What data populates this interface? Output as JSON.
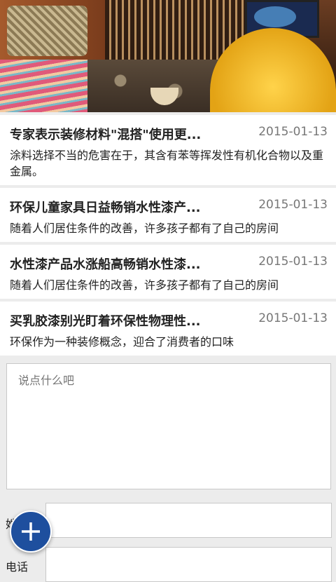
{
  "news": [
    {
      "title": "专家表示装修材料\"混搭\"使用更...",
      "date": "2015-01-13",
      "summary": "涂料选择不当的危害在于，其含有苯等挥发性有机化合物以及重金属。"
    },
    {
      "title": "环保儿童家具日益畅销水性漆产...",
      "date": "2015-01-13",
      "summary": "随着人们居住条件的改善，许多孩子都有了自己的房间"
    },
    {
      "title": "水性漆产品水涨船高畅销水性漆...",
      "date": "2015-01-13",
      "summary": "随着人们居住条件的改善，许多孩子都有了自己的房间"
    },
    {
      "title": "买乳胶漆别光盯着环保性物理性...",
      "date": "2015-01-13",
      "summary": "环保作为一种装修概念，迎合了消费者的口味"
    }
  ],
  "form": {
    "comment_placeholder": "说点什么吧",
    "name_label": "姓名",
    "phone_label": "电话"
  },
  "fab": {
    "icon": "plus-icon"
  }
}
